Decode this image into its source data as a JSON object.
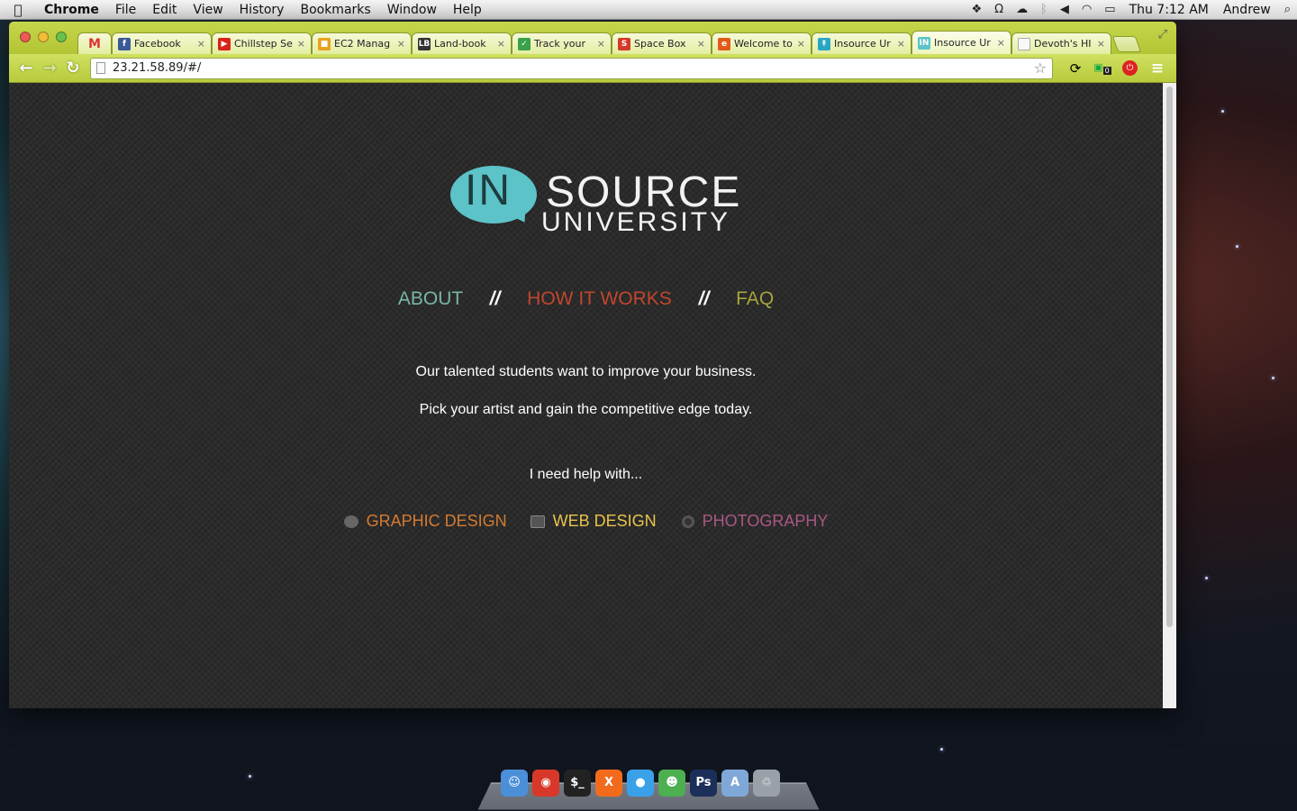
{
  "menubar": {
    "app": "Chrome",
    "menus": [
      "File",
      "Edit",
      "View",
      "History",
      "Bookmarks",
      "Window",
      "Help"
    ],
    "clock": "Thu 7:12 AM",
    "user": "Andrew"
  },
  "tabs": [
    {
      "title": "Facebook",
      "fav_color": "#3b5998",
      "fav_glyph": "f"
    },
    {
      "title": "Chillstep Se",
      "fav_color": "#d8231a",
      "fav_glyph": "▶"
    },
    {
      "title": "EC2 Manag",
      "fav_color": "#e9a21a",
      "fav_glyph": "■"
    },
    {
      "title": "Land-book",
      "fav_color": "#333333",
      "fav_glyph": "LB"
    },
    {
      "title": "Track your",
      "fav_color": "#3aa14a",
      "fav_glyph": "✓"
    },
    {
      "title": "Space Box",
      "fav_color": "#d33a2a",
      "fav_glyph": "S"
    },
    {
      "title": "Welcome to",
      "fav_color": "#e25a1a",
      "fav_glyph": "e"
    },
    {
      "title": "Insource Ur",
      "fav_color": "#2aa6c4",
      "fav_glyph": "↟"
    },
    {
      "title": "Insource Ur",
      "fav_color": "#5cc3c8",
      "fav_glyph": "IN",
      "active": true
    },
    {
      "title": "Devoth's HI",
      "fav_color": "#f8f8f8",
      "fav_glyph": ""
    }
  ],
  "toolbar": {
    "url": "23.21.58.89/#/",
    "badge_count": "0"
  },
  "page": {
    "logo_in": "IN",
    "logo_source": "SOURCE",
    "logo_university": "UNIVERSITY",
    "nav": {
      "about": "ABOUT",
      "how": "HOW IT WORKS",
      "faq": "FAQ",
      "sep": "//"
    },
    "tagline1": "Our talented students want to improve your business.",
    "tagline2": "Pick your artist and gain the competitive edge today.",
    "help_prompt": "I need help with...",
    "services": {
      "graphic": "GRAPHIC DESIGN",
      "web": "WEB DESIGN",
      "photo": "PHOTOGRAPHY"
    }
  },
  "colors": {
    "logo_bubble": "#5cc3c8",
    "about": "#7ab5a6",
    "how": "#c1462e",
    "faq": "#a8a43c",
    "graphic": "#d37b33",
    "web": "#e9c44a",
    "photo": "#a95784",
    "toolbar_theme": "#c6d64a"
  },
  "dock": [
    {
      "name": "finder-icon",
      "glyph": "☺",
      "color": "#4a8fd8"
    },
    {
      "name": "chrome-icon",
      "glyph": "◉",
      "color": "#d8382a"
    },
    {
      "name": "terminal-icon",
      "glyph": "$_",
      "color": "#222222"
    },
    {
      "name": "xampp-icon",
      "glyph": "X",
      "color": "#f26b1d"
    },
    {
      "name": "messages-icon",
      "glyph": "●",
      "color": "#3aa1e8"
    },
    {
      "name": "adium-icon",
      "glyph": "☻",
      "color": "#4caf50"
    },
    {
      "name": "photoshop-icon",
      "glyph": "Ps",
      "color": "#1c2f5a"
    },
    {
      "name": "applications-folder-icon",
      "glyph": "A",
      "color": "#7fa8d8"
    },
    {
      "name": "trash-icon",
      "glyph": "♲",
      "color": "#9aa0a8"
    }
  ]
}
